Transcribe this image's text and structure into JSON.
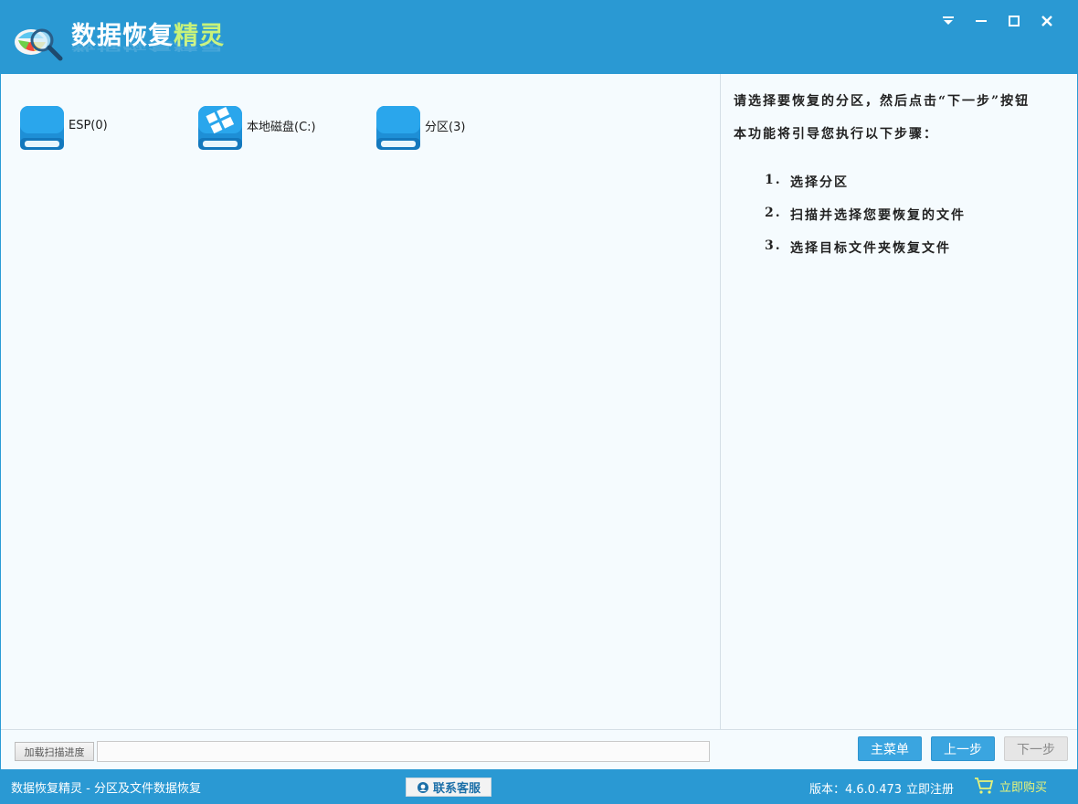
{
  "window": {
    "title_main": "数据恢复",
    "title_accent": "精灵",
    "colors": {
      "titlebar": "#2a99d3",
      "accent": "#c8f27a",
      "content_bg": "#f5fbfe"
    },
    "controls": [
      "menu-dropdown-icon",
      "minimize-icon",
      "maximize-icon",
      "close-icon"
    ]
  },
  "partitions": [
    {
      "label": "ESP(0)",
      "icon": "drive-icon"
    },
    {
      "label": "本地磁盘(C:)",
      "icon": "windows-drive-icon"
    },
    {
      "label": "分区(3)",
      "icon": "drive-icon"
    }
  ],
  "info": {
    "title": "请选择要恢复的分区，然后点击“下一步”按钮",
    "subtitle": "本功能将引导您执行以下步骤：",
    "steps": [
      {
        "num": "1.",
        "text": "选择分区"
      },
      {
        "num": "2.",
        "text": "扫描并选择您要恢复的文件"
      },
      {
        "num": "3.",
        "text": "选择目标文件夹恢复文件"
      }
    ]
  },
  "toolbar": {
    "load_label": "加载扫描进度",
    "main_menu_label": "主菜单",
    "prev_label": "上一步",
    "next_label": "下一步"
  },
  "status": {
    "left_text": "数据恢复精灵 - 分区及文件数据恢复",
    "contact_label": "联系客服",
    "version_text": "版本：4.6.0.473",
    "register_label": "立即注册",
    "buy_label": "立即购买",
    "buy_color": "#e7f37a"
  }
}
